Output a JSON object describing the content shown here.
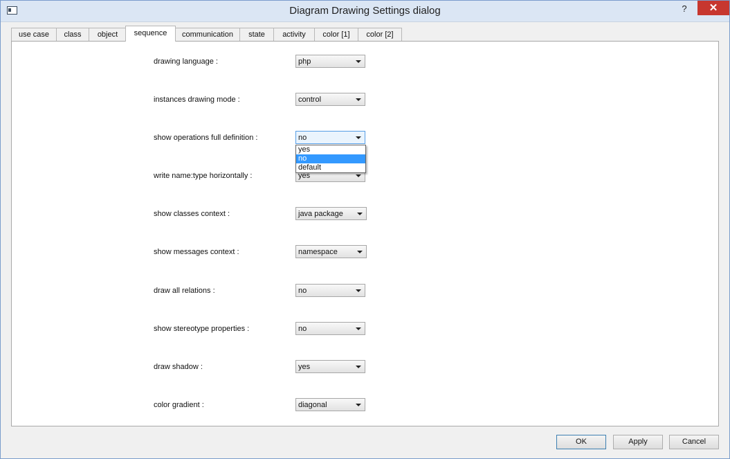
{
  "window": {
    "title": "Diagram Drawing Settings dialog",
    "help_label": "?",
    "close_label": "✕"
  },
  "tabs": [
    {
      "label": "use case"
    },
    {
      "label": "class"
    },
    {
      "label": "object"
    },
    {
      "label": "sequence",
      "active": true
    },
    {
      "label": "communication"
    },
    {
      "label": "state"
    },
    {
      "label": "activity"
    },
    {
      "label": "color [1]"
    },
    {
      "label": "color [2]"
    }
  ],
  "settings": [
    {
      "label": "drawing language :",
      "value": "php"
    },
    {
      "label": "instances drawing mode :",
      "value": "control"
    },
    {
      "label": "show operations full definition :",
      "value": "no"
    },
    {
      "label": "write name:type horizontally :",
      "value": "yes"
    },
    {
      "label": "show classes context :",
      "value": "java package"
    },
    {
      "label": "show messages context :",
      "value": "namespace"
    },
    {
      "label": "draw all relations :",
      "value": "no"
    },
    {
      "label": "show stereotype properties :",
      "value": "no"
    },
    {
      "label": "draw shadow :",
      "value": "yes"
    },
    {
      "label": "color gradient :",
      "value": "diagonal"
    }
  ],
  "dropdown": {
    "options": [
      "yes",
      "no",
      "default"
    ],
    "selected": "no"
  },
  "buttons": {
    "ok": "OK",
    "apply": "Apply",
    "cancel": "Cancel"
  },
  "colors": {
    "accent": "#3399ff",
    "close": "#c7372f"
  }
}
